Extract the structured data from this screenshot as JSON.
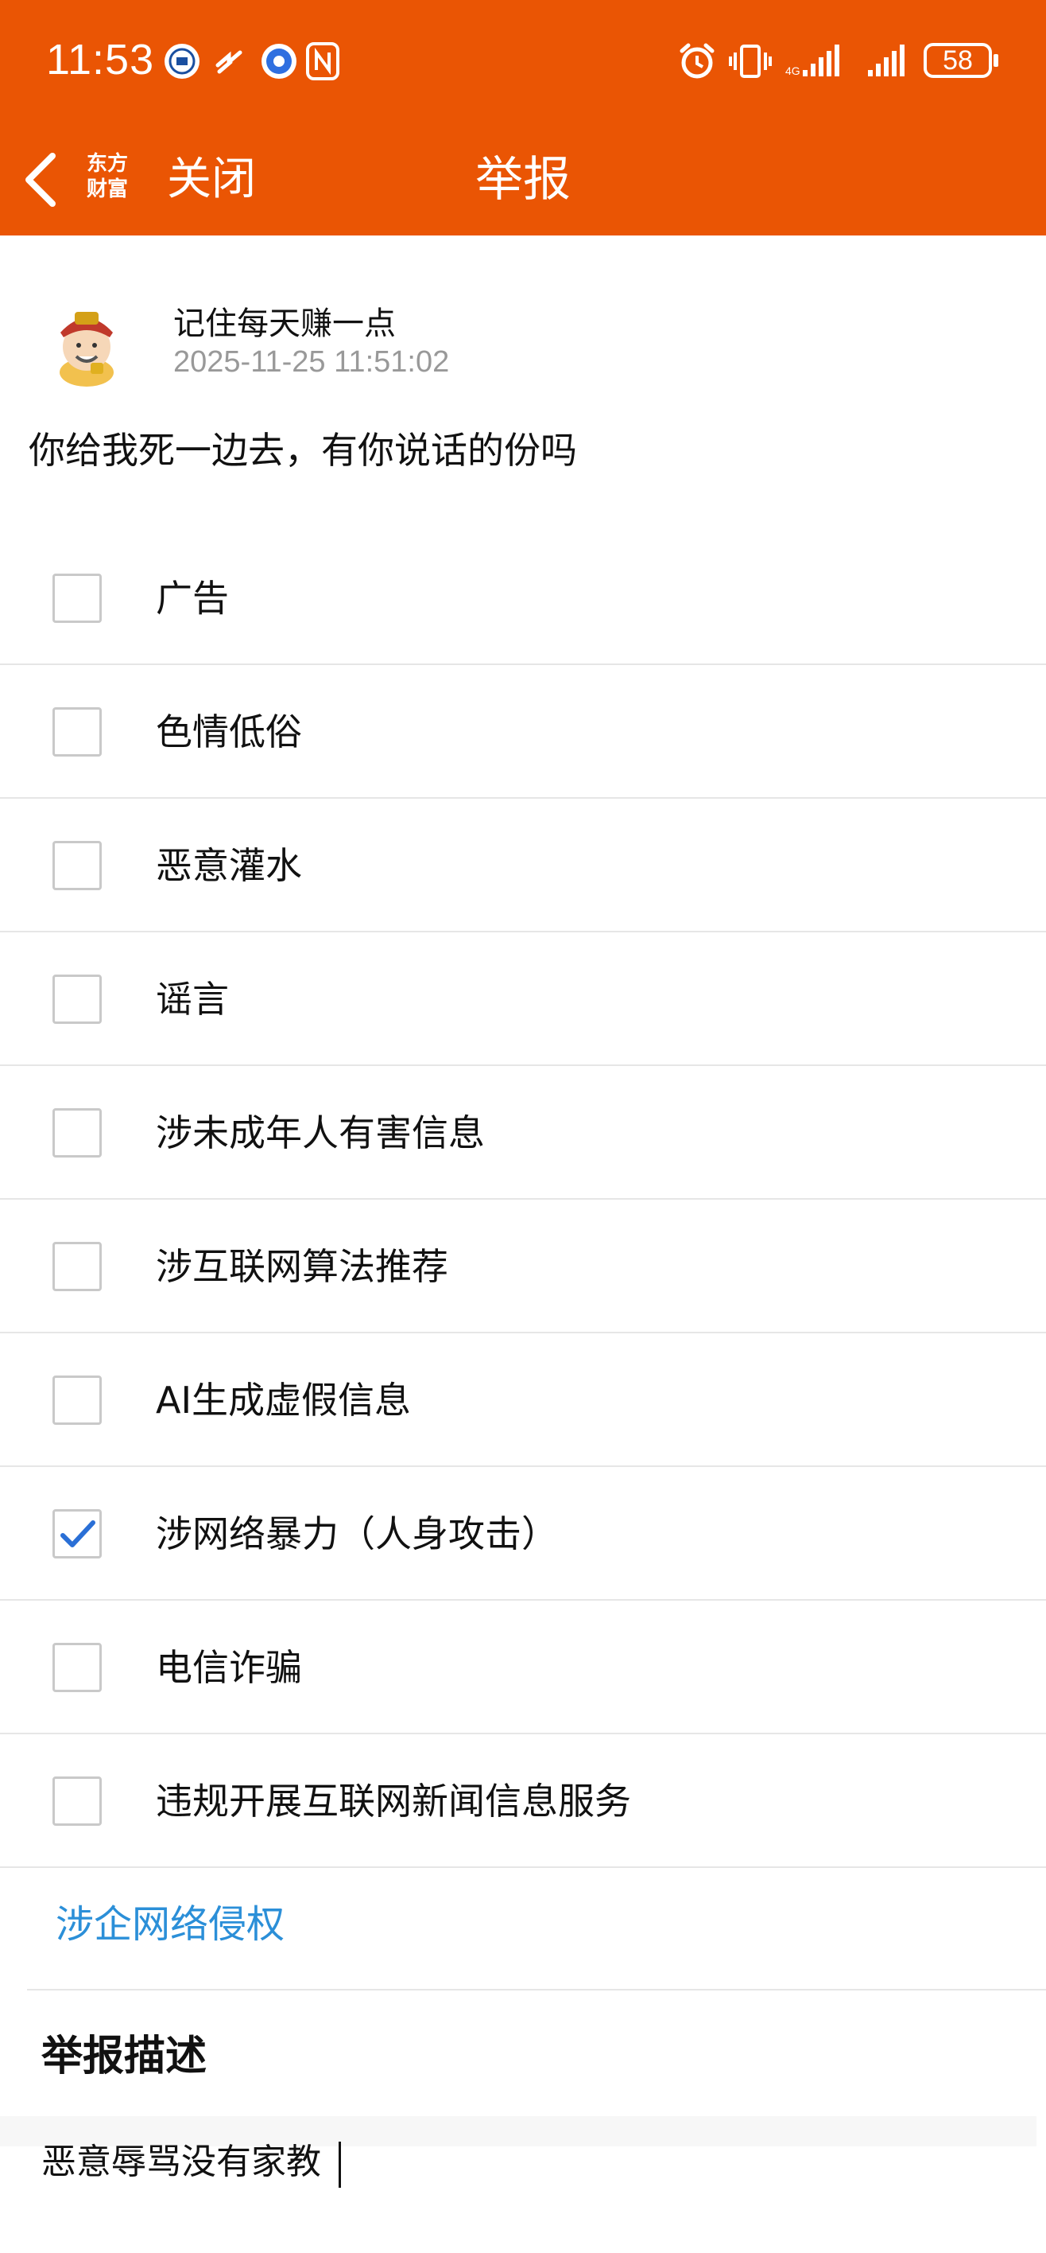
{
  "status_bar": {
    "time": "11:53",
    "battery": "58"
  },
  "nav": {
    "logo_line1": "东方",
    "logo_line2": "财富",
    "close_label": "关闭",
    "title": "举报"
  },
  "post": {
    "username": "记住每天赚一点",
    "timestamp": "2025-11-25 11:51:02",
    "content": "你给我死一边去，有你说话的份吗"
  },
  "options": [
    {
      "label": "广告",
      "checked": false
    },
    {
      "label": "色情低俗",
      "checked": false
    },
    {
      "label": "恶意灌水",
      "checked": false
    },
    {
      "label": "谣言",
      "checked": false
    },
    {
      "label": "涉未成年人有害信息",
      "checked": false
    },
    {
      "label": "涉互联网算法推荐",
      "checked": false
    },
    {
      "label": "AI生成虚假信息",
      "checked": false
    },
    {
      "label": "涉网络暴力（人身攻击）",
      "checked": true
    },
    {
      "label": "电信诈骗",
      "checked": false
    },
    {
      "label": "违规开展互联网新闻信息服务",
      "checked": false
    }
  ],
  "corp_link": "涉企网络侵权",
  "description": {
    "heading": "举报描述",
    "value": "恶意辱骂没有家教"
  },
  "colors": {
    "brand_orange": "#ea5504",
    "link_blue": "#2b8fd8",
    "check_blue": "#2a6fd6"
  },
  "icons": [
    "sim-icon",
    "broadcast-icon",
    "shield-icon",
    "nfc-icon",
    "alarm-icon",
    "vibrate-icon",
    "signal-icon",
    "battery-icon",
    "back-arrow-icon",
    "checkmark-icon"
  ]
}
